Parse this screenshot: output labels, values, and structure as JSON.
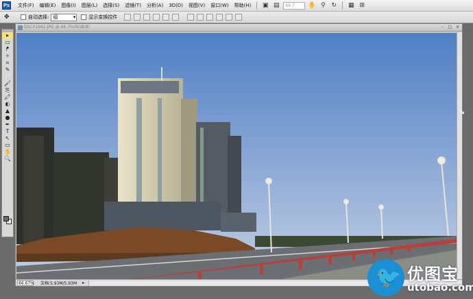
{
  "menubar": {
    "logo": "Ps",
    "items": [
      "文件(F)",
      "编辑(E)",
      "图像(I)",
      "图层(L)",
      "选择(S)",
      "滤镜(T)",
      "分析(A)",
      "3D(D)",
      "视图(V)",
      "窗口(W)",
      "帮助(H)"
    ],
    "zoom_value": "66.7",
    "icons": [
      "bridge-icon",
      "arrange-icon",
      "hand-icon",
      "zoom-icon",
      "rotate-icon",
      "screen-mode-icon",
      "extras-icon"
    ]
  },
  "options": {
    "tool_icon": "move-tool-icon",
    "auto_select_label": "自动选择:",
    "auto_select_value": "组",
    "show_transform_label": "显示变换控件"
  },
  "tools": [
    "▸",
    "▭",
    "ᖰ",
    "✧",
    "⌗",
    "✎",
    "🩹",
    "🖌",
    "⎘",
    "🖍",
    "◐",
    "▲",
    "●",
    "✒",
    "T",
    "↖",
    "▭",
    "✋",
    "🔍"
  ],
  "document": {
    "title": "DSC01662.JPG @ 66.7%(RGB/8)",
    "zoom": "66.67%",
    "info": "文档:5.93M/5.93M"
  },
  "watermark": {
    "cn": "优图宝",
    "en": "utobao.com"
  },
  "colors": {
    "sky_top": "#4f7fc4",
    "sky_bottom": "#b8cbe3",
    "accent": "#1a8fd6"
  }
}
